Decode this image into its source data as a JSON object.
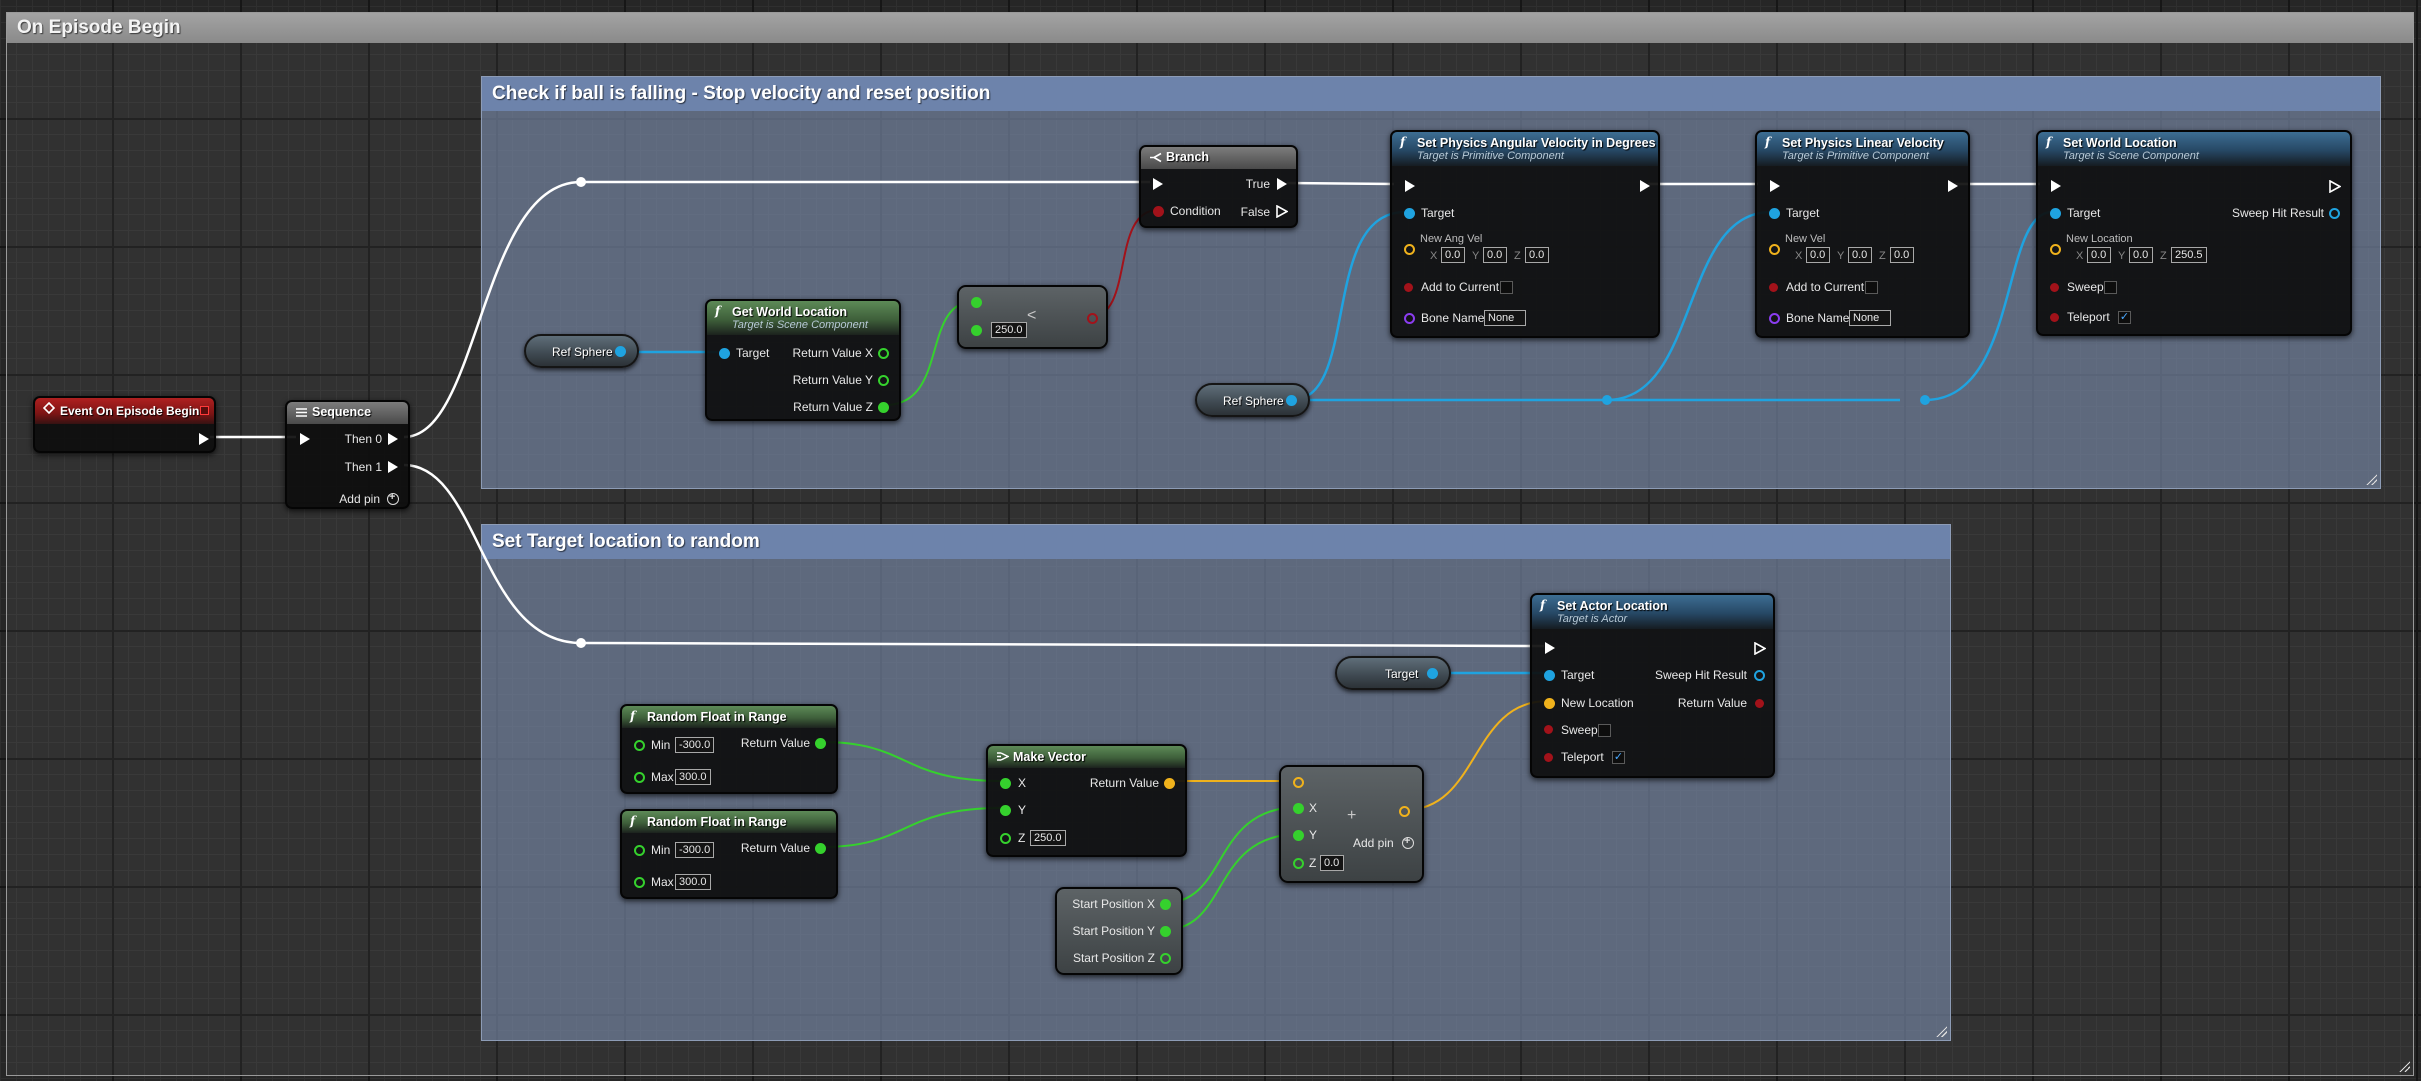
{
  "graph": {
    "outer_comment": "On Episode Begin",
    "comment_check": "Check if ball is falling - Stop velocity and reset position",
    "comment_target": "Set Target location to random"
  },
  "colors": {
    "exec": "#ffffff",
    "object": "#1fa3e0",
    "float": "#35d12d",
    "vector": "#f0b21c",
    "bool": "#a2121a",
    "name": "#8b3df0",
    "event_header": "#9b1b1b",
    "function_header": "#2d587a",
    "pure_header": "#4a7044"
  },
  "nodes": {
    "event": {
      "title": "Event On Episode Begin"
    },
    "sequence": {
      "title": "Sequence",
      "then0": "Then 0",
      "then1": "Then 1",
      "add_pin": "Add pin"
    },
    "ref_sphere_1": {
      "label": "Ref Sphere"
    },
    "ref_sphere_2": {
      "label": "Ref Sphere"
    },
    "get_world_location": {
      "title": "Get World Location",
      "subtitle": "Target is Scene Component",
      "target": "Target",
      "rx": "Return Value X",
      "ry": "Return Value Y",
      "rz": "Return Value Z"
    },
    "less_than": {
      "symbol": "<",
      "value": "250.0"
    },
    "branch": {
      "title": "Branch",
      "true": "True",
      "false": "False",
      "condition": "Condition"
    },
    "set_ang_vel": {
      "title": "Set Physics Angular Velocity in Degrees",
      "subtitle": "Target is Primitive Component",
      "target": "Target",
      "new_ang_vel": "New Ang Vel",
      "x_label": "X",
      "x": "0.0",
      "y_label": "Y",
      "y": "0.0",
      "z_label": "Z",
      "z": "0.0",
      "add_to_current": "Add to Current",
      "bone_name": "Bone Name",
      "bone_value": "None"
    },
    "set_lin_vel": {
      "title": "Set Physics Linear Velocity",
      "subtitle": "Target is Primitive Component",
      "target": "Target",
      "new_vel": "New Vel",
      "x_label": "X",
      "x": "0.0",
      "y_label": "Y",
      "y": "0.0",
      "z_label": "Z",
      "z": "0.0",
      "add_to_current": "Add to Current",
      "bone_name": "Bone Name",
      "bone_value": "None"
    },
    "set_world_location": {
      "title": "Set World Location",
      "subtitle": "Target is Scene Component",
      "target": "Target",
      "sweep_hit": "Sweep Hit Result",
      "new_location": "New Location",
      "x_label": "X",
      "x": "0.0",
      "y_label": "Y",
      "y": "0.0",
      "z_label": "Z",
      "z": "250.5",
      "sweep": "Sweep",
      "teleport": "Teleport",
      "teleport_checked": "✓"
    },
    "target_var": {
      "label": "Target"
    },
    "set_actor_location": {
      "title": "Set Actor Location",
      "subtitle": "Target is Actor",
      "target": "Target",
      "sweep_hit": "Sweep Hit Result",
      "new_location": "New Location",
      "return_value": "Return Value",
      "sweep": "Sweep",
      "teleport": "Teleport",
      "teleport_checked": "✓"
    },
    "rand_1": {
      "title": "Random Float in Range",
      "min": "Min",
      "min_value": "-300.0",
      "max": "Max",
      "max_value": "300.0",
      "ret": "Return Value"
    },
    "rand_2": {
      "title": "Random Float in Range",
      "min": "Min",
      "min_value": "-300.0",
      "max": "Max",
      "max_value": "300.0",
      "ret": "Return Value"
    },
    "make_vector": {
      "title": "Make Vector",
      "x": "X",
      "y": "Y",
      "z_label": "Z",
      "z": "250.0",
      "ret": "Return Value"
    },
    "add_vector": {
      "symbol": "+",
      "x": "X",
      "y": "Y",
      "z_label": "Z",
      "z": "0.0",
      "add_pin": "Add pin"
    },
    "start_pos": {
      "x": "Start Position X",
      "y": "Start Position Y",
      "z": "Start Position Z"
    }
  }
}
